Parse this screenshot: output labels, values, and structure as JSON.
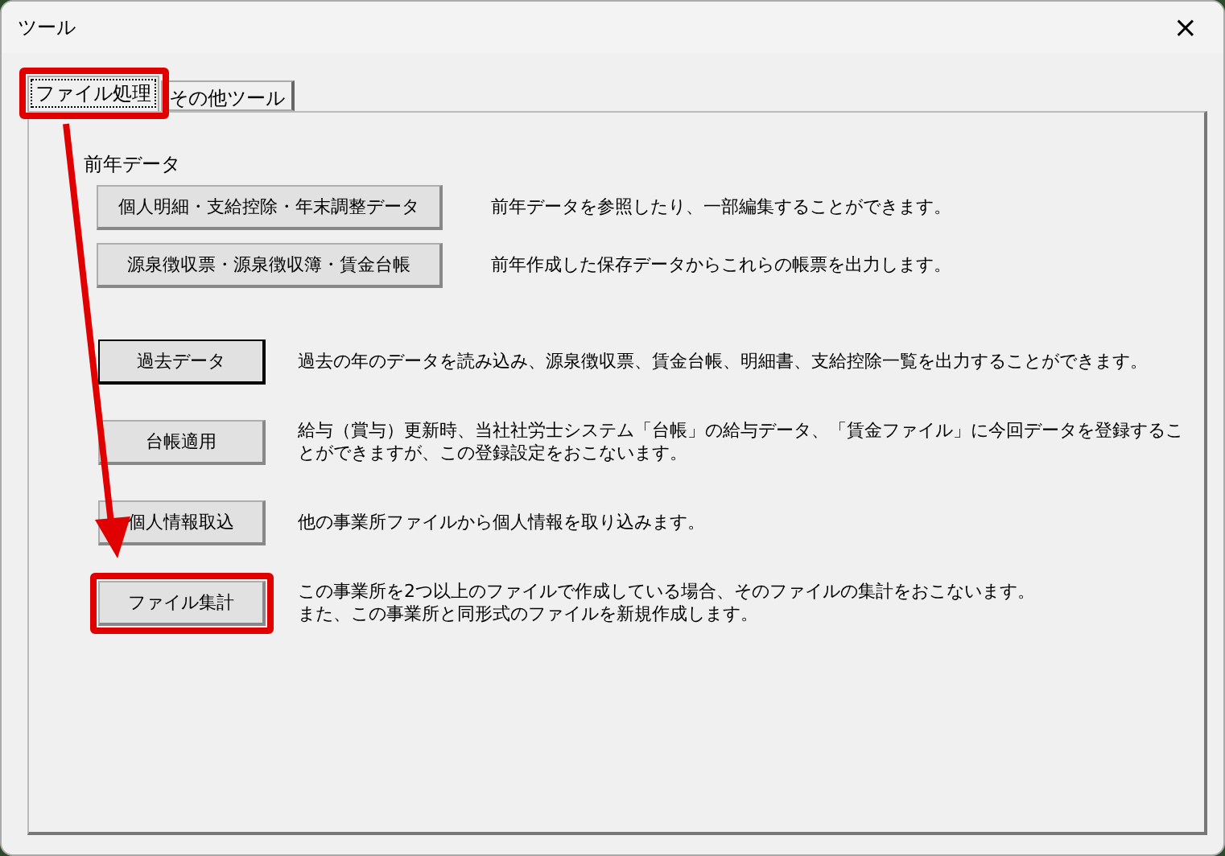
{
  "window": {
    "title": "ツール",
    "close": "×"
  },
  "tabs": [
    {
      "label": "ファイル処理",
      "selected": true,
      "highlighted": true
    },
    {
      "label": "その他ツール",
      "selected": false,
      "highlighted": false
    }
  ],
  "sections": [
    {
      "kind": "wide",
      "title": "前年データ",
      "items": [
        {
          "label": "個人明細・支給控除・年末調整データ",
          "default": false,
          "highlighted": false,
          "description": [
            "前年データを参照したり、一部編集することができます。"
          ]
        },
        {
          "label": "源泉徴収票・源泉徴収簿・賃金台帳",
          "default": false,
          "highlighted": false,
          "description": [
            "前年作成した保存データからこれらの帳票を出力します。"
          ]
        }
      ]
    },
    {
      "kind": "narrow",
      "items": [
        {
          "label": "過去データ",
          "default": true,
          "highlighted": false,
          "description": [
            "過去の年のデータを読み込み、源泉徴収票、賃金台帳、明細書、支給控除一覧を出力することができます。"
          ]
        },
        {
          "label": "台帳適用",
          "default": false,
          "highlighted": false,
          "description": [
            "給与（賞与）更新時、当社社労士システム「台帳」の給与データ、「賃金ファイル」に今回データを登録するこ",
            "とができますが、この登録設定をおこないます。"
          ]
        },
        {
          "label": "個人情報取込",
          "default": false,
          "highlighted": false,
          "description": [
            "他の事業所ファイルから個人情報を取り込みます。"
          ]
        },
        {
          "label": "ファイル集計",
          "default": false,
          "highlighted": true,
          "description": [
            "この事業所を2つ以上のファイルで作成している場合、そのファイルの集計をおこないます。",
            "また、この事業所と同形式のファイルを新規作成します。"
          ]
        }
      ]
    }
  ],
  "annotation_arrow": true
}
